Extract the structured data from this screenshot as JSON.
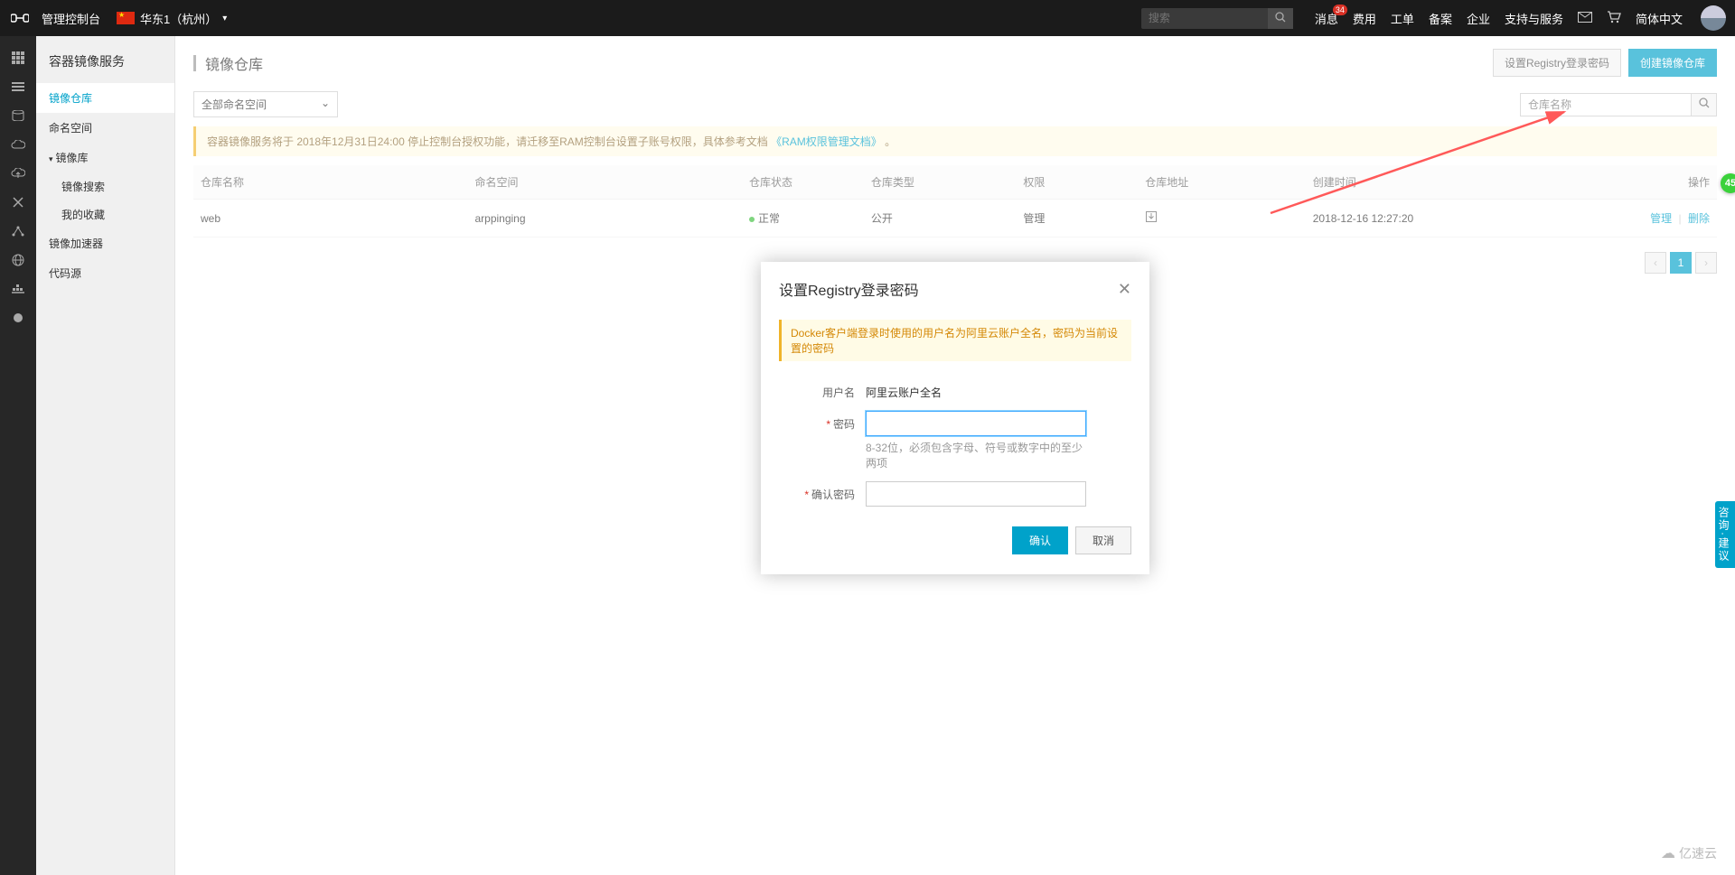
{
  "topbar": {
    "console": "管理控制台",
    "region": "华东1（杭州）",
    "search_placeholder": "搜索",
    "nav": {
      "messages": "消息",
      "messages_badge": "34",
      "fees": "费用",
      "tickets": "工单",
      "beian": "备案",
      "enterprise": "企业",
      "support": "支持与服务",
      "language": "简体中文"
    }
  },
  "sidebar": {
    "title": "容器镜像服务",
    "items": {
      "repos": "镜像仓库",
      "namespaces": "命名空间",
      "mirrors": "镜像库",
      "search": "镜像搜索",
      "favorites": "我的收藏",
      "accelerator": "镜像加速器",
      "source": "代码源"
    }
  },
  "page": {
    "title": "镜像仓库",
    "btn_set_pwd": "设置Registry登录密码",
    "btn_create": "创建镜像仓库",
    "ns_select": "全部命名空间",
    "name_search_placeholder": "仓库名称",
    "notice_prefix": "容器镜像服务将于 2018年12月31日24:00 停止控制台授权功能，请迁移至RAM控制台设置子账号权限，具体参考文档",
    "notice_link": "《RAM权限管理文档》",
    "notice_suffix": "。"
  },
  "table": {
    "headers": {
      "name": "仓库名称",
      "namespace": "命名空间",
      "status": "仓库状态",
      "type": "仓库类型",
      "perm": "权限",
      "addr": "仓库地址",
      "created": "创建时间",
      "ops": "操作"
    },
    "rows": [
      {
        "name": "web",
        "namespace": "arppinging",
        "status": "正常",
        "type": "公开",
        "perm": "管理",
        "created": "2018-12-16 12:27:20",
        "op_manage": "管理",
        "op_delete": "删除"
      }
    ]
  },
  "pager": {
    "current": "1"
  },
  "modal": {
    "title": "设置Registry登录密码",
    "notice": "Docker客户端登录时使用的用户名为阿里云账户全名，密码为当前设置的密码",
    "labels": {
      "user": "用户名",
      "pwd": "密码",
      "confirm": "确认密码"
    },
    "user_value": "阿里云账户全名",
    "pwd_hint": "8-32位，必须包含字母、符号或数字中的至少两项",
    "ok": "确认",
    "cancel": "取消"
  },
  "float": {
    "help": "咨询·建议",
    "plus": "45"
  },
  "watermark": "亿速云"
}
